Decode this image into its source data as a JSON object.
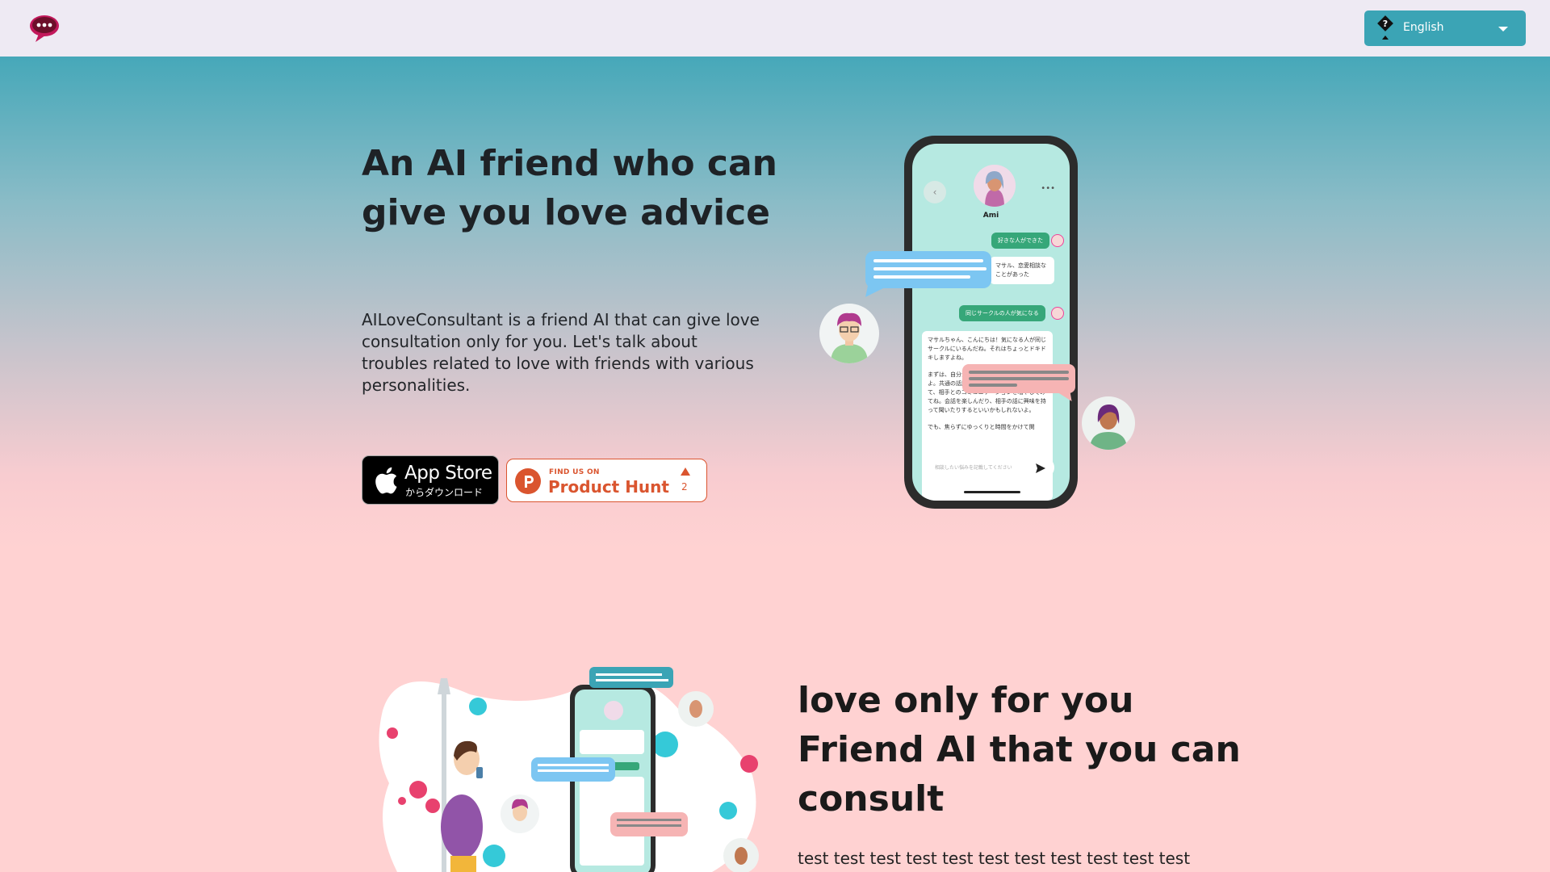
{
  "header": {
    "logo_icon": "chat-bubble-logo-icon",
    "language": {
      "selected": "English",
      "help_icon": "question-diamond-icon",
      "caret_icon": "caret-down-icon"
    }
  },
  "hero": {
    "title": "An AI friend who can give you love advice",
    "description": "AILoveConsultant is a friend AI that can give love consultation only for you. Let's talk about troubles related to love with friends with various personalities.",
    "app_store": {
      "main": "App Store",
      "sub": "からダウンロード",
      "icon": "apple-icon"
    },
    "product_hunt": {
      "small": "FIND US ON",
      "main": "Product Hunt",
      "count": "2",
      "icon": "product-hunt-icon"
    }
  },
  "phone": {
    "contact_name": "Ami",
    "messages": [
      {
        "who": "user",
        "text": "好きな人ができた"
      },
      {
        "who": "ai",
        "text": "マサル、恋愛相談なことがあった"
      },
      {
        "who": "user",
        "text": "同じサークルの人が気になる"
      },
      {
        "who": "ai",
        "text": "マサルちゃん、こんにちは！気になる人が同じサークルにいるんだね。それはちょっとドキドキしますよね。"
      },
      {
        "who": "ai",
        "text": "まずは、自分から話しかけてみるのが大切だよ。共通の話題を見つけることがポイント。けて、相手とのコミュニケーションを増やしてみてね。会話を楽しんだり、相手の話に興味を持って聞いたりするといいかもしれないよ。"
      },
      {
        "who": "ai",
        "text": "でも、焦らずにゆっくりと時間をかけて関"
      }
    ],
    "input_placeholder": "相談したい悩みを記載してください"
  },
  "section2": {
    "title": "love only for you Friend AI that you can consult",
    "text": "test test test test test test test test test test test"
  },
  "colors": {
    "header_bg": "#eeeaf3",
    "accent": "#3ba4b5",
    "pink_bg": "#ffd2d2",
    "product_hunt": "#da552f"
  }
}
